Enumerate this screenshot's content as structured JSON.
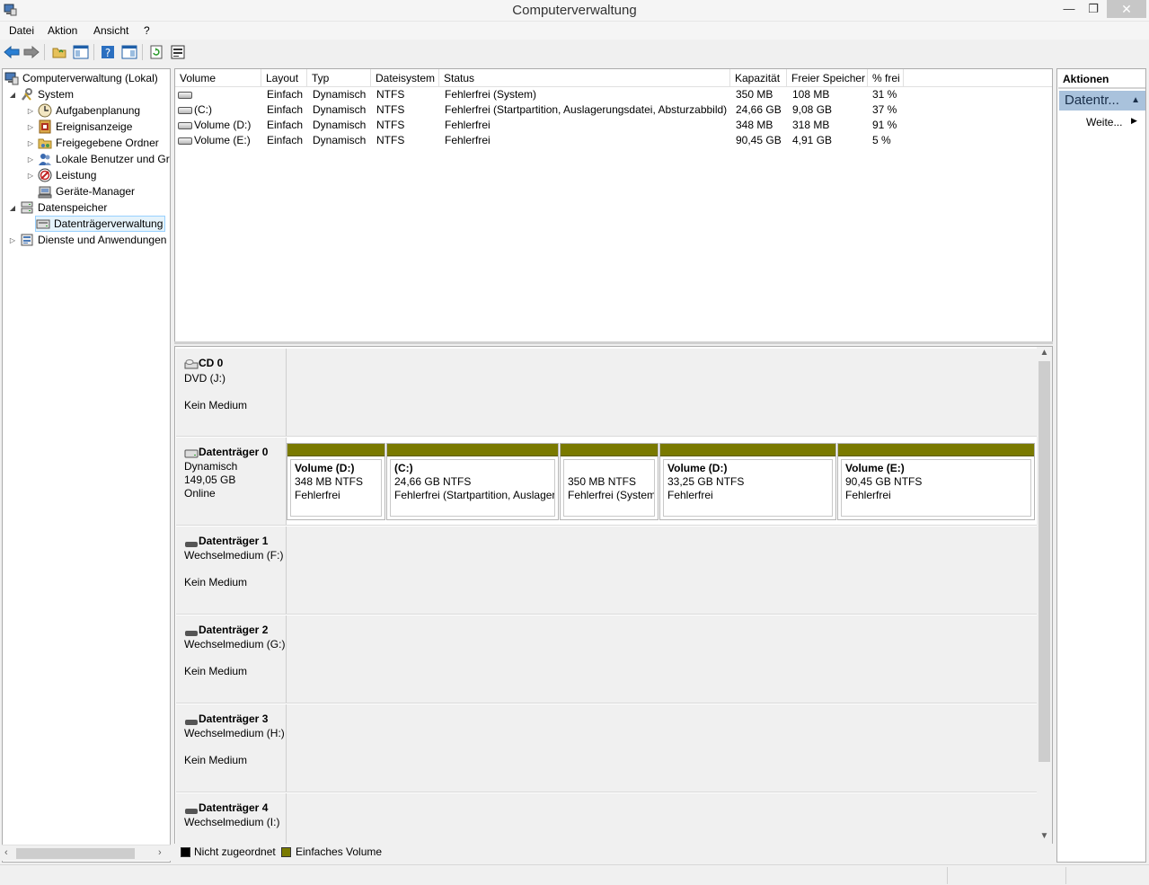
{
  "window": {
    "title": "Computerverwaltung",
    "minimize": "—",
    "maximize": "❐",
    "close": "✕"
  },
  "menu": [
    "Datei",
    "Aktion",
    "Ansicht",
    "?"
  ],
  "toolbar": {
    "icons": [
      "back-arrow-icon",
      "forward-arrow-icon",
      "up-folder-icon",
      "show-hide-tree-icon",
      "help-icon",
      "show-hide-action-pane-icon",
      "refresh-icon",
      "properties-icon"
    ]
  },
  "tree": {
    "items": [
      {
        "label": "Computerverwaltung (Lokal)",
        "expander": "",
        "icon": "computer-management-icon"
      },
      {
        "label": "System",
        "expander": "◢",
        "icon": "system-tools-icon"
      },
      {
        "label": "Aufgabenplanung",
        "expander": "▷",
        "icon": "clock-icon"
      },
      {
        "label": "Ereignisanzeige",
        "expander": "▷",
        "icon": "event-viewer-icon"
      },
      {
        "label": "Freigegebene Ordner",
        "expander": "▷",
        "icon": "shared-folder-icon"
      },
      {
        "label": "Lokale Benutzer und Gruppen",
        "expander": "▷",
        "icon": "users-icon"
      },
      {
        "label": "Leistung",
        "expander": "▷",
        "icon": "performance-icon"
      },
      {
        "label": "Geräte-Manager",
        "expander": "",
        "icon": "device-manager-icon"
      },
      {
        "label": "Datenspeicher",
        "expander": "◢",
        "icon": "storage-icon"
      },
      {
        "label": "Datenträgerverwaltung",
        "expander": "",
        "icon": "disk-management-icon"
      },
      {
        "label": "Dienste und Anwendungen",
        "expander": "▷",
        "icon": "services-icon"
      }
    ]
  },
  "volume_list": {
    "columns": [
      "Volume",
      "Layout",
      "Typ",
      "Dateisystem",
      "Status",
      "Kapazität",
      "Freier Speicher",
      "% frei"
    ],
    "rows": [
      {
        "volume": "",
        "layout": "Einfach",
        "typ": "Dynamisch",
        "fs": "NTFS",
        "status": "Fehlerfrei (System)",
        "cap": "350 MB",
        "free": "108 MB",
        "pct": "31 %"
      },
      {
        "volume": "(C:)",
        "layout": "Einfach",
        "typ": "Dynamisch",
        "fs": "NTFS",
        "status": "Fehlerfrei (Startpartition, Auslagerungsdatei, Absturzabbild)",
        "cap": "24,66 GB",
        "free": "9,08 GB",
        "pct": "37 %"
      },
      {
        "volume": "Volume (D:)",
        "layout": "Einfach",
        "typ": "Dynamisch",
        "fs": "NTFS",
        "status": "Fehlerfrei",
        "cap": "348 MB",
        "free": "318 MB",
        "pct": "91 %"
      },
      {
        "volume": "Volume (E:)",
        "layout": "Einfach",
        "typ": "Dynamisch",
        "fs": "NTFS",
        "status": "Fehlerfrei",
        "cap": "90,45 GB",
        "free": "4,91 GB",
        "pct": "5 %"
      }
    ]
  },
  "disks": [
    {
      "title": "CD 0",
      "line1": "DVD (J:)",
      "line2": "",
      "line3": "Kein Medium",
      "icon": "cd-drive-icon",
      "partitions": []
    },
    {
      "title": "Datenträger 0",
      "line1": "Dynamisch",
      "line2": "149,05 GB",
      "line3": "Online",
      "icon": "hard-disk-icon",
      "partitions": [
        {
          "name": "Volume  (D:)",
          "size": "348 MB NTFS",
          "status": "Fehlerfrei"
        },
        {
          "name": "(C:)",
          "size": "24,66 GB NTFS",
          "status": "Fehlerfrei (Startpartition, Auslagerungsdatei, Absturzabbild)"
        },
        {
          "name": "",
          "size": "350 MB NTFS",
          "status": "Fehlerfrei (System)"
        },
        {
          "name": "Volume  (D:)",
          "size": "33,25 GB NTFS",
          "status": "Fehlerfrei"
        },
        {
          "name": "Volume  (E:)",
          "size": "90,45 GB NTFS",
          "status": "Fehlerfrei"
        }
      ]
    },
    {
      "title": "Datenträger 1",
      "line1": "Wechselmedium (F:)",
      "line2": "",
      "line3": "Kein Medium",
      "icon": "removable-disk-icon",
      "partitions": []
    },
    {
      "title": "Datenträger 2",
      "line1": "Wechselmedium (G:)",
      "line2": "",
      "line3": "Kein Medium",
      "icon": "removable-disk-icon",
      "partitions": []
    },
    {
      "title": "Datenträger 3",
      "line1": "Wechselmedium (H:)",
      "line2": "",
      "line3": "Kein Medium",
      "icon": "removable-disk-icon",
      "partitions": []
    },
    {
      "title": "Datenträger 4",
      "line1": "Wechselmedium (I:)",
      "line2": "",
      "line3": "",
      "icon": "removable-disk-icon",
      "partitions": []
    }
  ],
  "legend": [
    {
      "label": "Nicht zugeordnet",
      "color": "#000000"
    },
    {
      "label": "Einfaches Volume",
      "color": "#7a7a00"
    }
  ],
  "actions": {
    "title": "Aktionen",
    "section": "Datentr...",
    "more": "Weite..."
  },
  "colors": {
    "simple_volume": "#7a7a00",
    "unallocated": "#000000",
    "selection": "#e5f3fb"
  }
}
